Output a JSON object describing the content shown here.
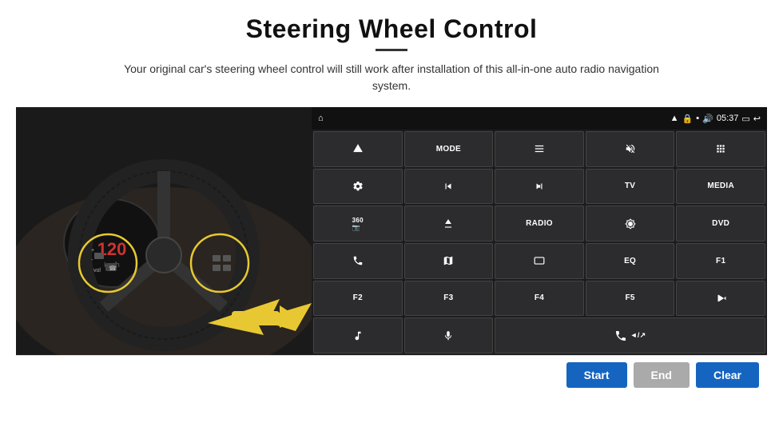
{
  "header": {
    "title": "Steering Wheel Control",
    "subtitle": "Your original car's steering wheel control will still work after installation of this all-in-one auto radio navigation system."
  },
  "status_bar": {
    "time": "05:37",
    "home_icon": "⌂",
    "icons_right": [
      "wifi",
      "lock",
      "sd",
      "volume",
      "screen",
      "back"
    ]
  },
  "buttons": [
    {
      "id": "row1-col1",
      "type": "icon",
      "label": "nav"
    },
    {
      "id": "row1-col2",
      "type": "text",
      "label": "MODE"
    },
    {
      "id": "row1-col3",
      "type": "icon",
      "label": "list"
    },
    {
      "id": "row1-col4",
      "type": "icon",
      "label": "mute"
    },
    {
      "id": "row1-col5",
      "type": "icon",
      "label": "apps"
    },
    {
      "id": "row2-col1",
      "type": "icon",
      "label": "settings"
    },
    {
      "id": "row2-col2",
      "type": "icon",
      "label": "prev"
    },
    {
      "id": "row2-col3",
      "type": "icon",
      "label": "next"
    },
    {
      "id": "row2-col4",
      "type": "text",
      "label": "TV"
    },
    {
      "id": "row2-col5",
      "type": "text",
      "label": "MEDIA"
    },
    {
      "id": "row3-col1",
      "type": "icon",
      "label": "360"
    },
    {
      "id": "row3-col2",
      "type": "icon",
      "label": "eject"
    },
    {
      "id": "row3-col3",
      "type": "text",
      "label": "RADIO"
    },
    {
      "id": "row3-col4",
      "type": "icon",
      "label": "brightness"
    },
    {
      "id": "row3-col5",
      "type": "text",
      "label": "DVD"
    },
    {
      "id": "row4-col1",
      "type": "icon",
      "label": "phone"
    },
    {
      "id": "row4-col2",
      "type": "icon",
      "label": "map"
    },
    {
      "id": "row4-col3",
      "type": "icon",
      "label": "screen-off"
    },
    {
      "id": "row4-col4",
      "type": "text",
      "label": "EQ"
    },
    {
      "id": "row4-col5",
      "type": "text",
      "label": "F1"
    },
    {
      "id": "row5-col1",
      "type": "text",
      "label": "F2"
    },
    {
      "id": "row5-col2",
      "type": "text",
      "label": "F3"
    },
    {
      "id": "row5-col3",
      "type": "text",
      "label": "F4"
    },
    {
      "id": "row5-col4",
      "type": "text",
      "label": "F5"
    },
    {
      "id": "row5-col5",
      "type": "icon",
      "label": "play-pause"
    },
    {
      "id": "row6-col1",
      "type": "icon",
      "label": "music"
    },
    {
      "id": "row6-col2",
      "type": "icon",
      "label": "mic"
    },
    {
      "id": "row6-col3",
      "type": "icon",
      "label": "phone-call",
      "wide": true
    }
  ],
  "bottom_buttons": {
    "start": "Start",
    "end": "End",
    "clear": "Clear"
  }
}
